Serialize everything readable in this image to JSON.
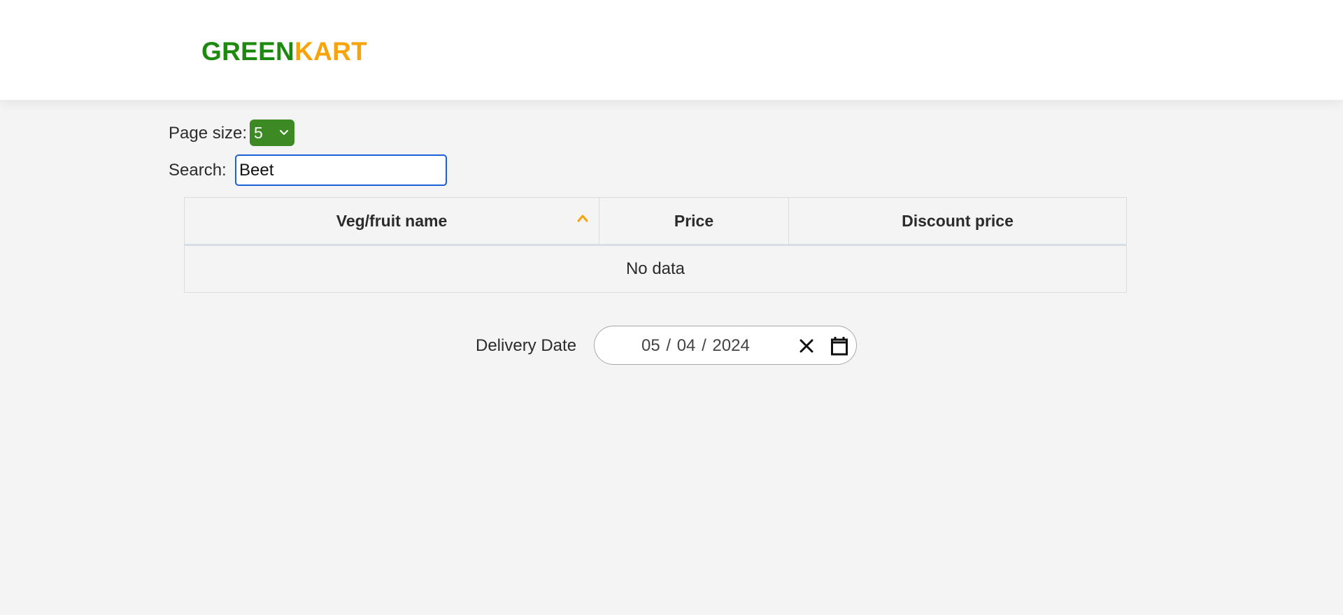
{
  "brand": {
    "part1": "GREEN",
    "part2": "KART",
    "color1": "#1d8a0f",
    "color2": "#f9a30a"
  },
  "controls": {
    "page_size_label": "Page size:",
    "page_size_value": "5",
    "search_label": "Search:",
    "search_value": "Beet"
  },
  "table": {
    "columns": [
      "Veg/fruit name",
      "Price",
      "Discount price"
    ],
    "sorted_column_icon": "chevron-up-icon",
    "empty_text": "No data"
  },
  "delivery": {
    "label": "Delivery Date",
    "date_value": "05 / 04 / 2024",
    "clear_icon": "close-icon",
    "calendar_icon": "calendar-icon"
  },
  "colors": {
    "accent_green": "#3d8a24",
    "focus_blue": "#1a60d6",
    "sort_orange": "#f9a30a"
  }
}
